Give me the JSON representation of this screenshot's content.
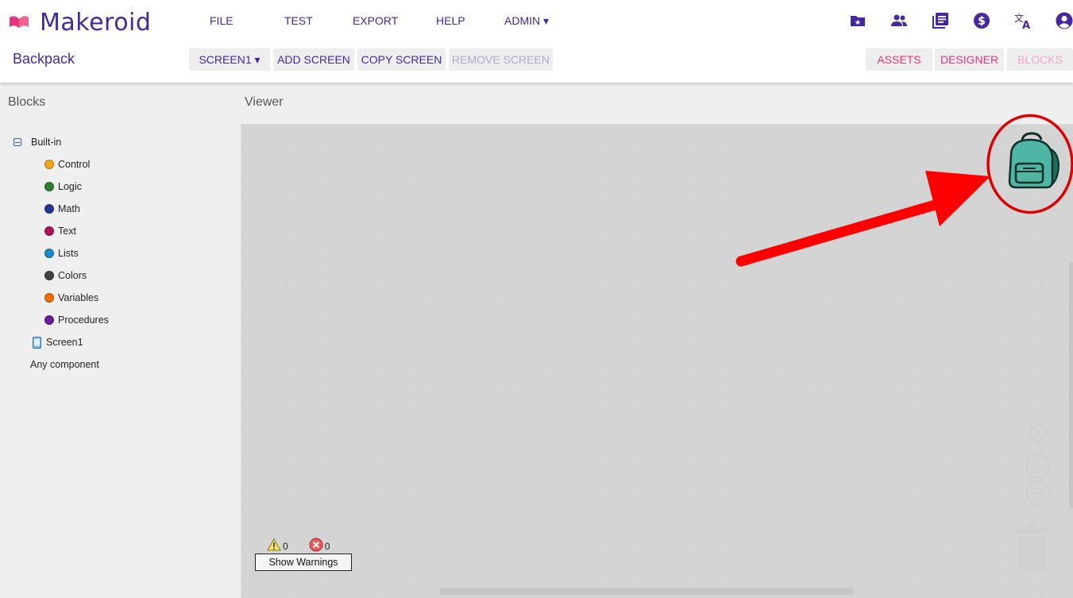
{
  "app": {
    "name": "Makeroid",
    "brand_color": "#4527a0",
    "accent_color": "#e5367d"
  },
  "menu": {
    "items": [
      "FILE",
      "TEST",
      "EXPORT",
      "HELP",
      "ADMIN ▾"
    ]
  },
  "header_icons": [
    "gallery-icon",
    "people-icon",
    "library-icon",
    "dollar-icon",
    "translate-icon",
    "account-icon"
  ],
  "project": {
    "name": "Backpack"
  },
  "toolbar": {
    "screen_select": "SCREEN1 ▾",
    "add_screen": "ADD SCREEN",
    "copy_screen": "COPY SCREEN",
    "remove_screen": "REMOVE SCREEN",
    "assets": "ASSETS",
    "designer": "DESIGNER",
    "blocks": "BLOCKS"
  },
  "blocks_panel": {
    "title": "Blocks",
    "builtin_label": "Built-in",
    "categories": [
      {
        "label": "Control",
        "color": "#f2a31f"
      },
      {
        "label": "Logic",
        "color": "#2e7d32"
      },
      {
        "label": "Math",
        "color": "#283593"
      },
      {
        "label": "Text",
        "color": "#ad1457"
      },
      {
        "label": "Lists",
        "color": "#1e88c6"
      },
      {
        "label": "Colors",
        "color": "#424242"
      },
      {
        "label": "Variables",
        "color": "#ef6c00"
      },
      {
        "label": "Procedures",
        "color": "#6a1b9a"
      }
    ],
    "screen_label": "Screen1",
    "any_component": "Any component"
  },
  "viewer": {
    "title": "Viewer",
    "warnings_count": "0",
    "errors_count": "0",
    "show_warnings": "Show Warnings"
  }
}
